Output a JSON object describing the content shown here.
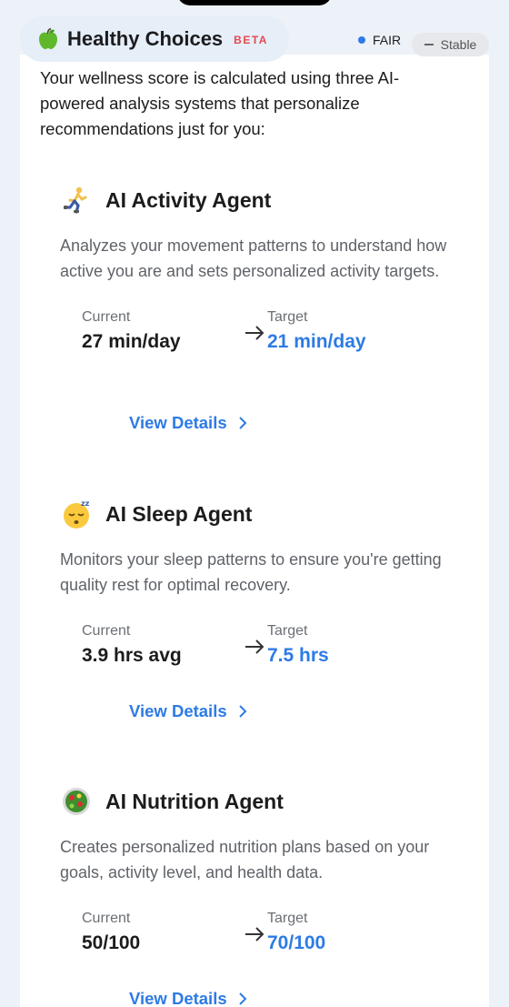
{
  "header": {
    "title": "Healthy Choices",
    "badge": "BETA",
    "status_label": "FAIR",
    "status_color": "#2d7be5",
    "trend_label": "Stable",
    "icon": "green-apple-icon"
  },
  "intro": "Your wellness score is calculated using three AI-powered analysis systems that personalize recommendations just for you:",
  "agents": [
    {
      "icon": "running-person-icon",
      "title": "AI Activity Agent",
      "description": "Analyzes your movement patterns to understand how active you are and sets personalized activity targets.",
      "current_label": "Current",
      "current_value": "27 min/day",
      "target_label": "Target",
      "target_value": "21 min/day",
      "link": "View Details"
    },
    {
      "icon": "sleeping-face-icon",
      "title": "AI Sleep Agent",
      "description": "Monitors your sleep patterns to ensure you're getting quality rest for optimal recovery.",
      "current_label": "Current",
      "current_value": "3.9 hrs avg",
      "target_label": "Target",
      "target_value": "7.5 hrs",
      "link": "View Details"
    },
    {
      "icon": "salad-icon",
      "title": "AI Nutrition Agent",
      "description": "Creates personalized nutrition plans based on your goals, activity level, and health data.",
      "current_label": "Current",
      "current_value": "50/100",
      "target_label": "Target",
      "target_value": "70/100",
      "link": "View Details"
    }
  ]
}
